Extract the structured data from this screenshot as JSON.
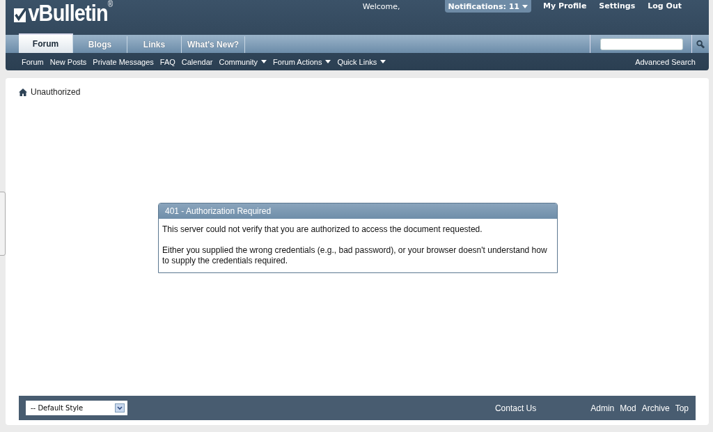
{
  "logo": {
    "text": "vBulletin",
    "mark": "®"
  },
  "user_links": [
    {
      "label": "Welcome,",
      "kind": "text"
    },
    {
      "label": "Notifications: 11",
      "kind": "dropdown"
    },
    {
      "label": "My Profile",
      "kind": "link"
    },
    {
      "label": "Settings",
      "kind": "link"
    },
    {
      "label": "Log Out",
      "kind": "link"
    }
  ],
  "tabs": [
    {
      "label": "Forum",
      "selected": true
    },
    {
      "label": "Blogs",
      "selected": false
    },
    {
      "label": "Links",
      "selected": false
    },
    {
      "label": "What's New?",
      "selected": false
    }
  ],
  "subnav": [
    {
      "label": "Forum",
      "kind": "link"
    },
    {
      "label": "New Posts",
      "kind": "link"
    },
    {
      "label": "Private Messages",
      "kind": "link"
    },
    {
      "label": "FAQ",
      "kind": "link"
    },
    {
      "label": "Calendar",
      "kind": "link"
    },
    {
      "label": "Community",
      "kind": "dropdown"
    },
    {
      "label": "Forum Actions",
      "kind": "dropdown"
    },
    {
      "label": "Quick Links",
      "kind": "dropdown"
    }
  ],
  "advanced_search": "Advanced Search",
  "breadcrumb": "Unauthorized",
  "error": {
    "title": "401 - Authorization Required",
    "paragraphs": [
      "This server could not verify that you are authorized to access the document requested.",
      "Either you supplied the wrong credentials (e.g., bad password), or your browser doesn't understand how to supply the credentials required."
    ]
  },
  "footer": {
    "style_select": "-- Default Style",
    "contact": "Contact Us",
    "links": [
      "Admin",
      "Mod",
      "Archive",
      "Top"
    ]
  }
}
